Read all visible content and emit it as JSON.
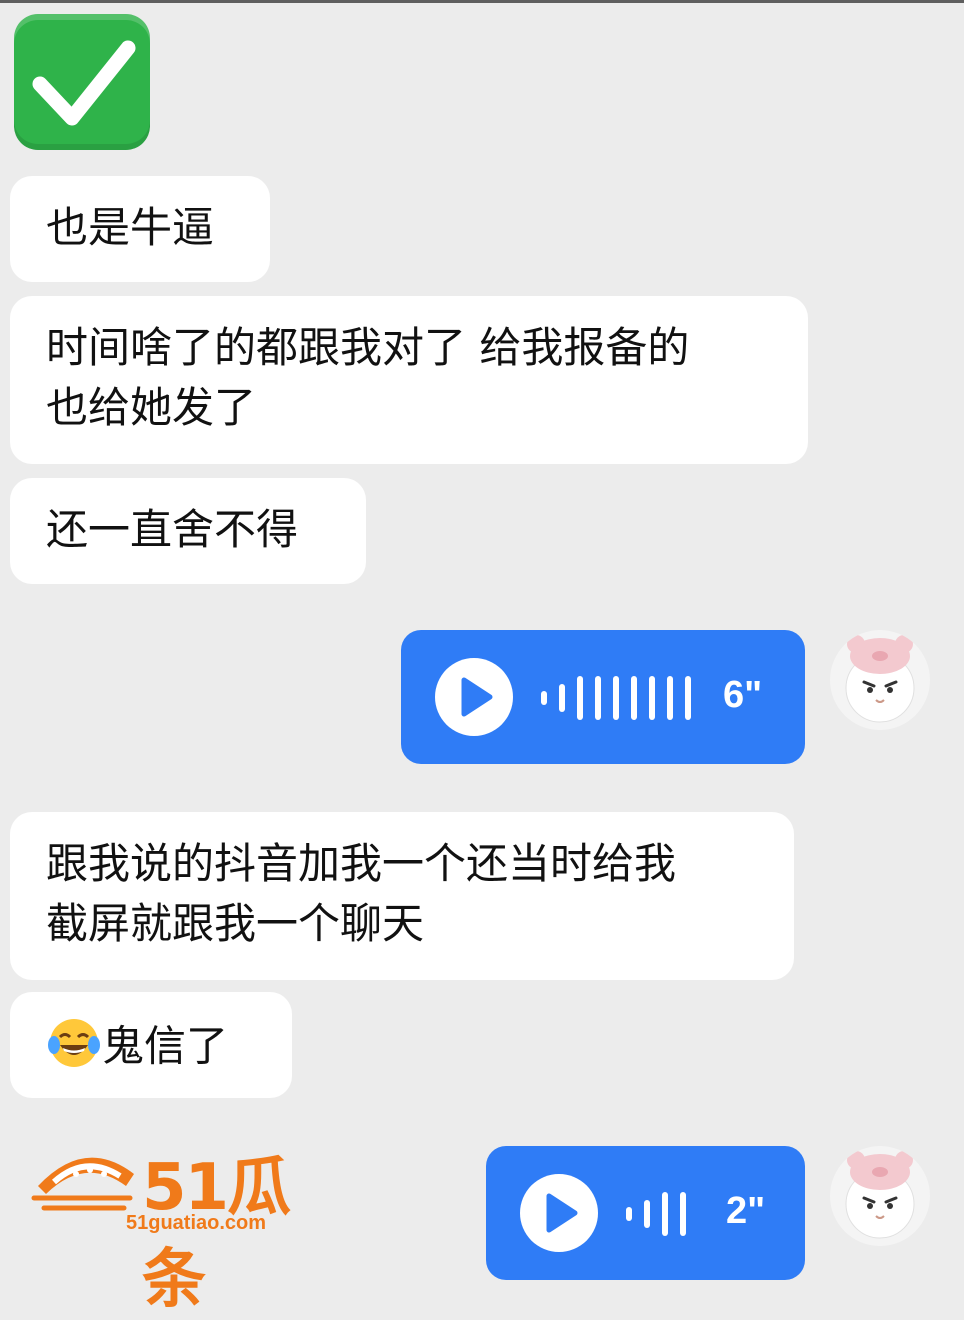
{
  "header_emoji": "check-mark-button-icon",
  "messages": [
    {
      "side": "left",
      "type": "text",
      "lines": [
        "也是牛逼"
      ]
    },
    {
      "side": "left",
      "type": "text",
      "lines": [
        "时间啥了的都跟我对了 给我报备的",
        "也给她发了"
      ]
    },
    {
      "side": "left",
      "type": "text",
      "lines": [
        "还一直舍不得"
      ]
    },
    {
      "side": "right",
      "type": "voice",
      "duration": "6\""
    },
    {
      "side": "left",
      "type": "text",
      "lines": [
        "跟我说的抖音加我一个还当时给我",
        "截屏就跟我一个聊天"
      ]
    },
    {
      "side": "left",
      "type": "text",
      "emoji": "tears-of-joy-icon",
      "lines": [
        "鬼信了"
      ]
    },
    {
      "side": "right",
      "type": "voice",
      "duration": "2\""
    }
  ],
  "watermark": {
    "title": "51瓜条",
    "url": "51guatiao.com"
  },
  "colors": {
    "background": "#ececec",
    "bubble_left": "#ffffff",
    "bubble_voice": "#2f7cf6",
    "check_green": "#2fb34a",
    "watermark_orange": "#f07a1a"
  }
}
